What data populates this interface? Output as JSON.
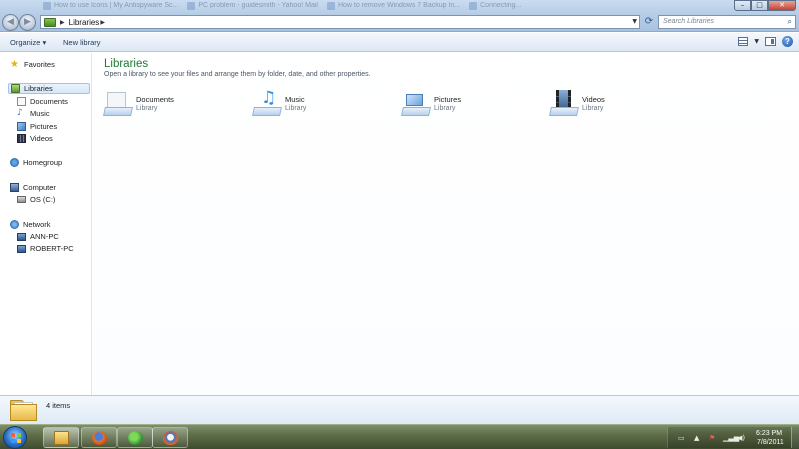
{
  "window": {
    "background_tabs": [
      "How to use Icons | My Antispyware Sc...",
      "PC problem - guidesmith - Yahoo! Mail",
      "How to remove Windows 7 Backup In...",
      "Connecting..."
    ],
    "controls": {
      "minimize": "–",
      "maximize": "□",
      "close": "✕"
    }
  },
  "address": {
    "path": [
      "Libraries"
    ],
    "search_placeholder": "Search Libraries"
  },
  "toolbar": {
    "organize_label": "Organize ▾",
    "new_library_label": "New library"
  },
  "navigation": {
    "favorites": "Favorites",
    "libraries": "Libraries",
    "library_items": [
      "Documents",
      "Music",
      "Pictures",
      "Videos"
    ],
    "homegroup": "Homegroup",
    "computer": "Computer",
    "computer_items": [
      "OS (C:)"
    ],
    "network": "Network",
    "network_items": [
      "ANN-PC",
      "ROBERT-PC"
    ]
  },
  "content": {
    "title": "Libraries",
    "subtitle": "Open a library to see your files and arrange them by folder, date, and other properties.",
    "libraries": [
      {
        "name": "Documents",
        "kind": "Library",
        "icon": "documents-library-icon"
      },
      {
        "name": "Music",
        "kind": "Library",
        "icon": "music-library-icon"
      },
      {
        "name": "Pictures",
        "kind": "Library",
        "icon": "pictures-library-icon"
      },
      {
        "name": "Videos",
        "kind": "Library",
        "icon": "videos-library-icon"
      }
    ]
  },
  "details": {
    "item_count": "4 items"
  },
  "taskbar": {
    "apps": [
      "windows-explorer",
      "firefox",
      "windows-live-messenger",
      "paint"
    ],
    "clock_time": "6:23 PM",
    "clock_date": "7/8/2011"
  },
  "colors": {
    "title_green": "#1d7a34",
    "selection_blue": "#9fc4ec",
    "taskbar": "#5f6f4a"
  }
}
